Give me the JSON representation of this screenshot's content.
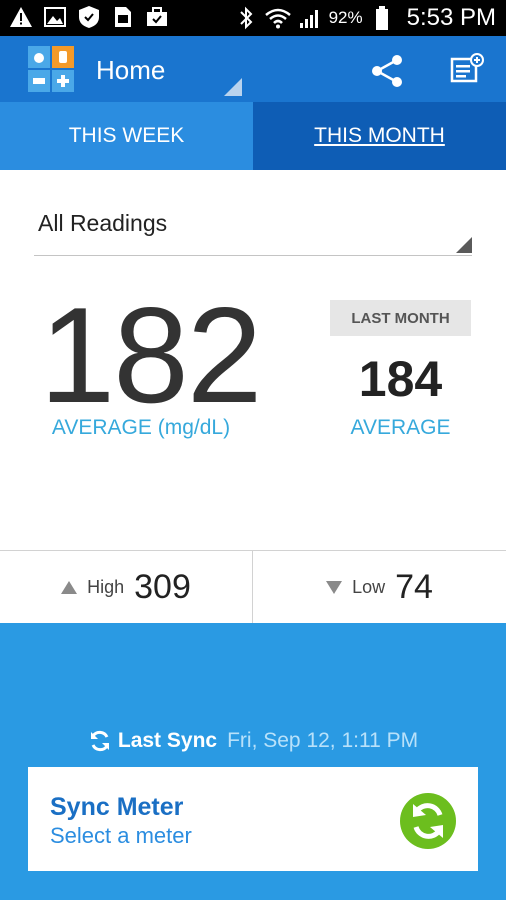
{
  "status_bar": {
    "battery_pct": "92%",
    "time": "5:53 PM",
    "icons": [
      "alert-icon",
      "image-icon",
      "shield-icon",
      "sim-icon",
      "briefcase-icon",
      "bluetooth-icon",
      "wifi-icon",
      "signal-icon",
      "battery-icon"
    ]
  },
  "app_bar": {
    "title": "Home",
    "accent": "#1a75cf"
  },
  "tabs": [
    {
      "label": "THIS WEEK",
      "selected": false
    },
    {
      "label": "THIS MONTH",
      "selected": true
    }
  ],
  "readings_filter": {
    "selected": "All Readings"
  },
  "average": {
    "value": "182",
    "label": "AVERAGE (mg/dL)"
  },
  "last_month": {
    "badge": "LAST MONTH",
    "value": "184",
    "label": "AVERAGE"
  },
  "high": {
    "label": "High",
    "value": "309"
  },
  "low": {
    "label": "Low",
    "value": "74"
  },
  "last_sync": {
    "label": "Last Sync",
    "date": "Fri, Sep 12, 1:11 PM"
  },
  "sync_meter": {
    "title": "Sync Meter",
    "subtitle": "Select a meter",
    "button_color": "#6cbe1e"
  }
}
